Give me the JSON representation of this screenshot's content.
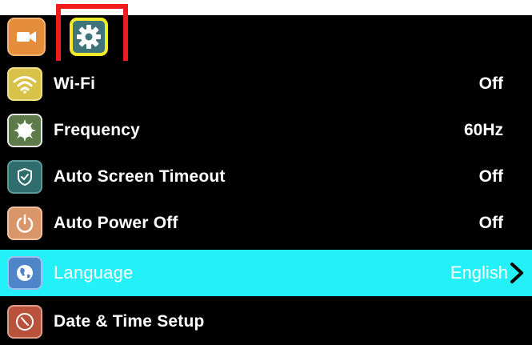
{
  "tabs": [
    {
      "icon": "video-camera-icon",
      "color": "#e48e3c"
    },
    {
      "icon": "gear-icon",
      "color": "#3e747a",
      "selected": true
    }
  ],
  "menu": {
    "items": [
      {
        "icon": "wifi-icon",
        "label": "Wi-Fi",
        "value": "Off"
      },
      {
        "icon": "flicker-frequency-icon",
        "label": "Frequency",
        "value": "60Hz"
      },
      {
        "icon": "shield-icon",
        "label": "Auto Screen Timeout",
        "value": "Off"
      },
      {
        "icon": "power-icon",
        "label": "Auto Power Off",
        "value": "Off"
      },
      {
        "icon": "globe-icon",
        "label": "Language",
        "value": "English",
        "selected": true
      },
      {
        "icon": "clock-icon",
        "label": "Date & Time Setup",
        "value": ""
      }
    ]
  },
  "colors": {
    "background": "#000000",
    "selected_row": "#24f1f7",
    "highlight_box": "#ee1c1c",
    "selected_tab_border": "#f0ec2a"
  }
}
